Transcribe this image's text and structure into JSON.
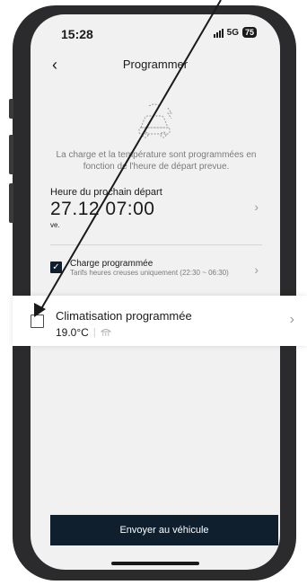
{
  "status_bar": {
    "time": "15:28",
    "network": "5G",
    "battery": "75"
  },
  "header": {
    "title": "Programmer"
  },
  "description": "La charge et la température sont programmées en fonction de l'heure de départ prevue.",
  "departure": {
    "label": "Heure du prochain départ",
    "datetime": "27.12 07:00",
    "day": "ve."
  },
  "charge": {
    "title": "Charge programmée",
    "subtitle": "Tarifs heures creuses uniquement (22:30 ~ 06:30)",
    "checked": true
  },
  "climatisation": {
    "title": "Climatisation programmée",
    "temperature": "19.0°C",
    "checked": false
  },
  "send_button": "Envoyer au véhicule",
  "colors": {
    "dark_navy": "#0f1f2e",
    "background": "#f1f1f1",
    "phone_frame": "#2b2b2d"
  }
}
